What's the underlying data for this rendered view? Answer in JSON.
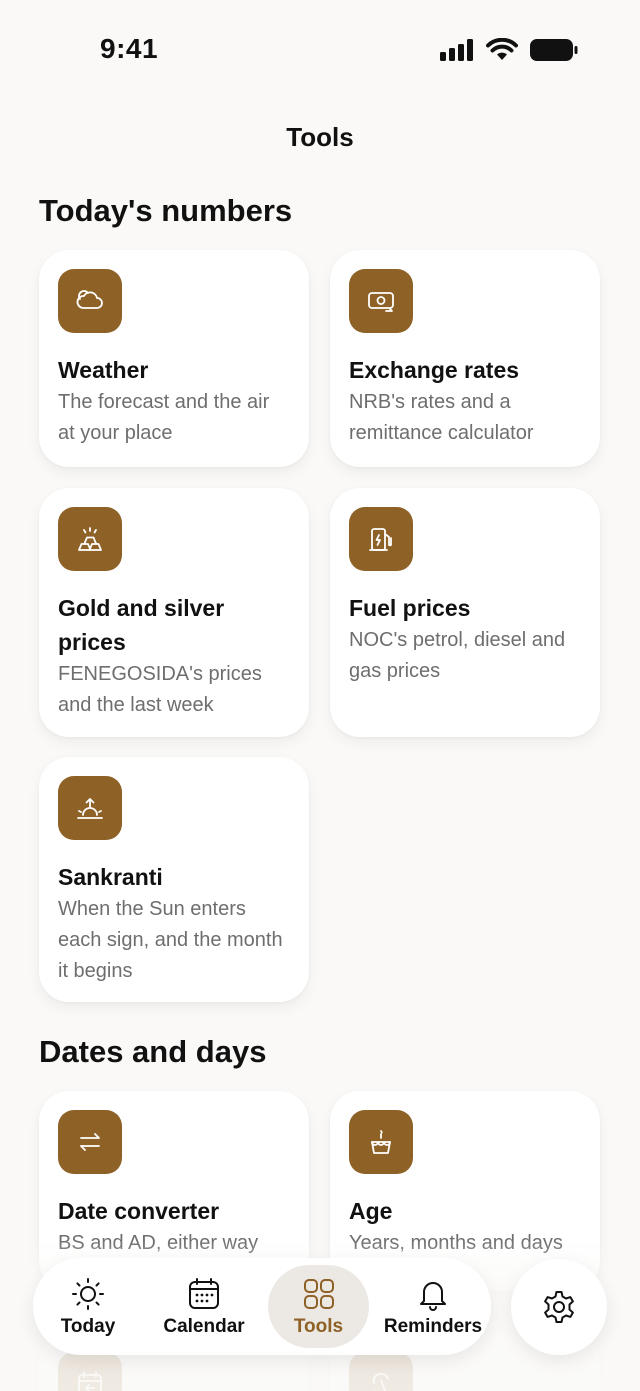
{
  "status_bar": {
    "time": "9:41",
    "icons": [
      "cellular-signal-icon",
      "wifi-icon",
      "battery-icon"
    ]
  },
  "header": {
    "title": "Tools"
  },
  "sections": [
    {
      "title": "Today's numbers",
      "cards": [
        {
          "title": "Weather",
          "description": "The forecast and the air at your place",
          "icon": "cloud-icon"
        },
        {
          "title": "Exchange rates",
          "description": "NRB's rates and a remittance calculator",
          "icon": "currency-exchange-icon"
        },
        {
          "title": "Gold and silver prices",
          "description": "FENEGOSIDA's prices and the last week",
          "icon": "gold-bars-icon"
        },
        {
          "title": "Fuel prices",
          "description": "NOC's petrol, diesel and gas prices",
          "icon": "fuel-pump-icon"
        },
        {
          "title": "Sankranti",
          "description": "When the Sun enters each sign, and the month it begins",
          "icon": "sunrise-icon"
        }
      ]
    },
    {
      "title": "Dates and days",
      "cards": [
        {
          "title": "Date converter",
          "description": "BS and AD, either way",
          "icon": "swap-arrows-icon"
        },
        {
          "title": "Age",
          "description": "Years, months and days",
          "icon": "birthday-cake-icon"
        },
        {
          "title": "",
          "description": "",
          "icon": "calendar-arrow-icon"
        },
        {
          "title": "",
          "description": "",
          "icon": "beach-icon"
        }
      ]
    }
  ],
  "tabbar": {
    "tabs": [
      {
        "label": "Today",
        "icon": "sun-icon",
        "active": false
      },
      {
        "label": "Calendar",
        "icon": "calendar-icon",
        "active": false
      },
      {
        "label": "Tools",
        "icon": "grid-icon",
        "active": true
      },
      {
        "label": "Reminders",
        "icon": "bell-icon",
        "active": false
      }
    ],
    "settings_icon": "gear-icon"
  },
  "colors": {
    "accent": "#8e6126",
    "background": "#faf9f7",
    "card": "#ffffff",
    "muted_text": "#6e6e6e"
  }
}
